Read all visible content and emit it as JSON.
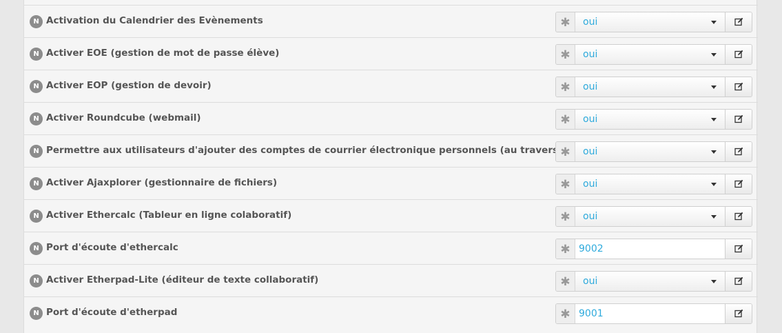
{
  "settings": [
    {
      "label": "Activation du Calendrier des Evènements",
      "type": "select",
      "value": "oui",
      "badge": "N"
    },
    {
      "label": "Activer EOE (gestion de mot de passe élève)",
      "type": "select",
      "value": "oui",
      "badge": "N"
    },
    {
      "label": "Activer EOP (gestion de devoir)",
      "type": "select",
      "value": "oui",
      "badge": "N"
    },
    {
      "label": "Activer Roundcube (webmail)",
      "type": "select",
      "value": "oui",
      "badge": "N"
    },
    {
      "label": "Permettre aux utilisateurs d'ajouter des comptes de courrier électronique personnels (au travers d'un serveur pop)",
      "type": "select",
      "value": "oui",
      "badge": "N"
    },
    {
      "label": "Activer Ajaxplorer (gestionnaire de fichiers)",
      "type": "select",
      "value": "oui",
      "badge": "N"
    },
    {
      "label": "Activer Ethercalc (Tableur en ligne colaboratif)",
      "type": "select",
      "value": "oui",
      "badge": "N"
    },
    {
      "label": "Port d'écoute d'ethercalc",
      "type": "input",
      "value": "9002",
      "badge": "N"
    },
    {
      "label": "Activer Etherpad-Lite (éditeur de texte collaboratif)",
      "type": "select",
      "value": "oui",
      "badge": "N"
    },
    {
      "label": "Port d'écoute d'etherpad",
      "type": "input",
      "value": "9001",
      "badge": "N"
    }
  ],
  "icons": {
    "required": "asterisk-icon",
    "edit": "edit-icon",
    "badge": "normal-mode-badge",
    "dropdown": "caret-down-icon"
  },
  "colors": {
    "value_text": "#2eaadc",
    "label_text": "#555555",
    "badge_bg": "#8c8c8c",
    "row_bg": "#f5f5f5"
  }
}
